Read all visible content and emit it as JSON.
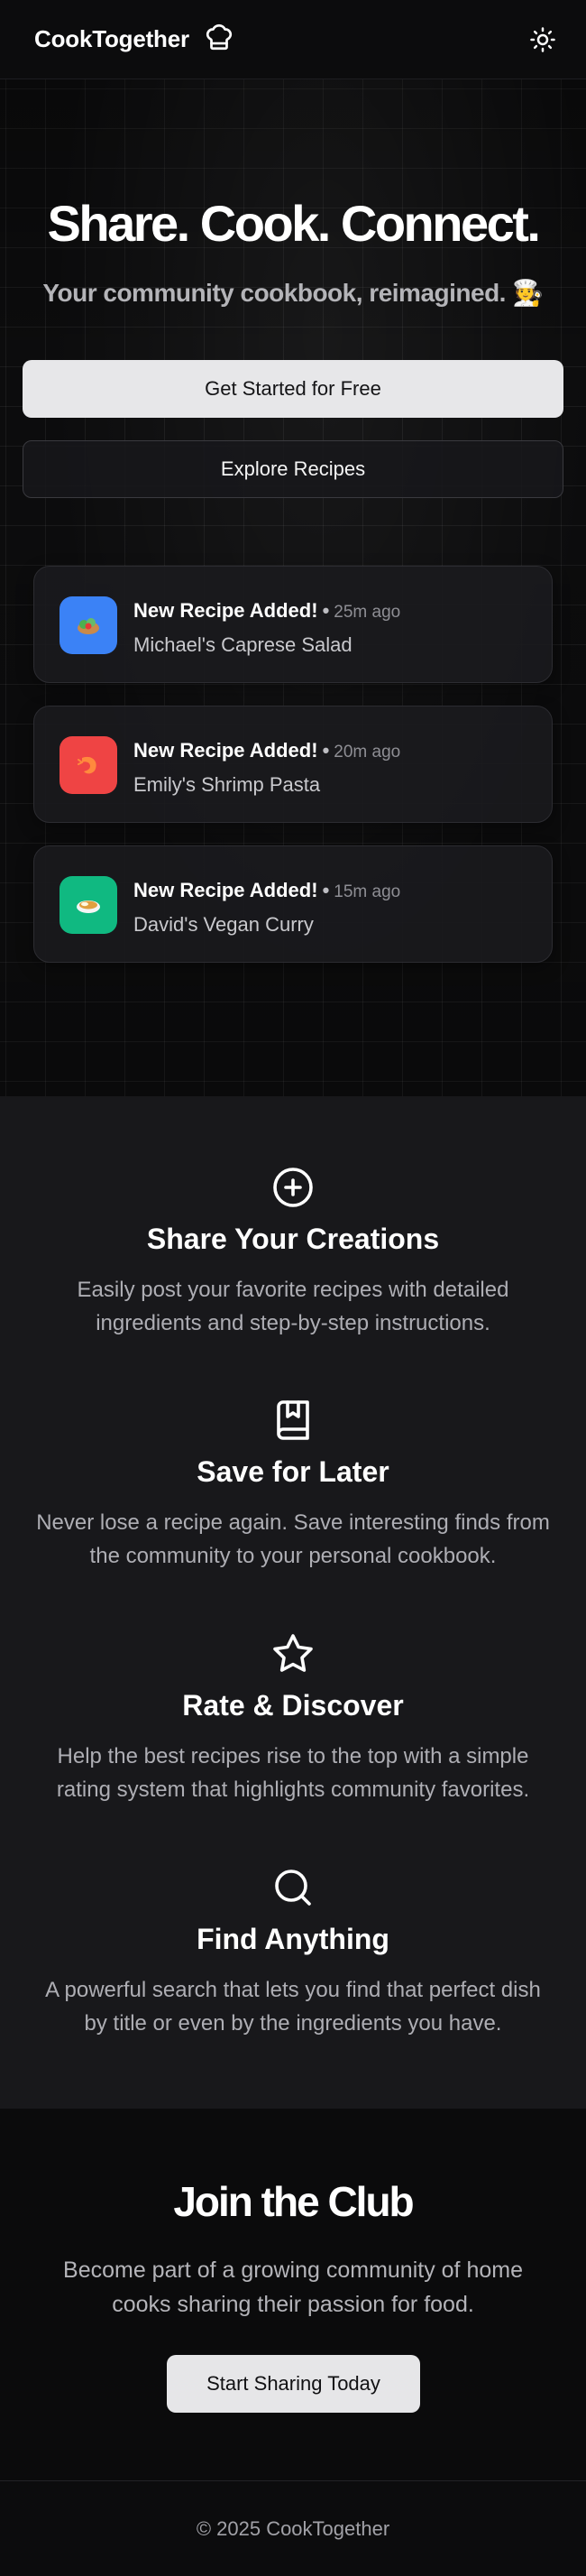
{
  "header": {
    "brand": "CookTogether",
    "logo_icon": "chef-hat-icon",
    "theme_icon": "sun-icon"
  },
  "hero": {
    "title": "Share. Cook. Connect.",
    "subtitle": "Your community cookbook, reimagined. 🧑‍🍳",
    "primary_button": "Get Started for Free",
    "secondary_button": "Explore Recipes",
    "feed": [
      {
        "title": "New Recipe Added!",
        "separator": "•",
        "time": "25m ago",
        "recipe": "Michael's Caprese Salad",
        "avatar_color": "#3b82f6",
        "emoji": "🥗"
      },
      {
        "title": "New Recipe Added!",
        "separator": "•",
        "time": "20m ago",
        "recipe": "Emily's Shrimp Pasta",
        "avatar_color": "#ef4444",
        "emoji": "🍤"
      },
      {
        "title": "New Recipe Added!",
        "separator": "•",
        "time": "15m ago",
        "recipe": "David's Vegan Curry",
        "avatar_color": "#10b981",
        "emoji": "🍛"
      }
    ]
  },
  "features": [
    {
      "icon": "plus-circle-icon",
      "title": "Share Your Creations",
      "desc": "Easily post your favorite recipes with detailed ingredients and step-by-step instructions."
    },
    {
      "icon": "bookmark-icon",
      "title": "Save for Later",
      "desc": "Never lose a recipe again. Save interesting finds from the community to your personal cookbook."
    },
    {
      "icon": "star-icon",
      "title": "Rate & Discover",
      "desc": "Help the best recipes rise to the top with a simple rating system that highlights community favorites."
    },
    {
      "icon": "search-icon",
      "title": "Find Anything",
      "desc": "A powerful search that lets you find that perfect dish by title or even by the ingredients you have."
    }
  ],
  "join": {
    "title": "Join the Club",
    "desc": "Become part of a growing community of home cooks sharing their passion for food.",
    "button": "Start Sharing Today"
  },
  "footer": {
    "text": "© 2025 CookTogether"
  }
}
